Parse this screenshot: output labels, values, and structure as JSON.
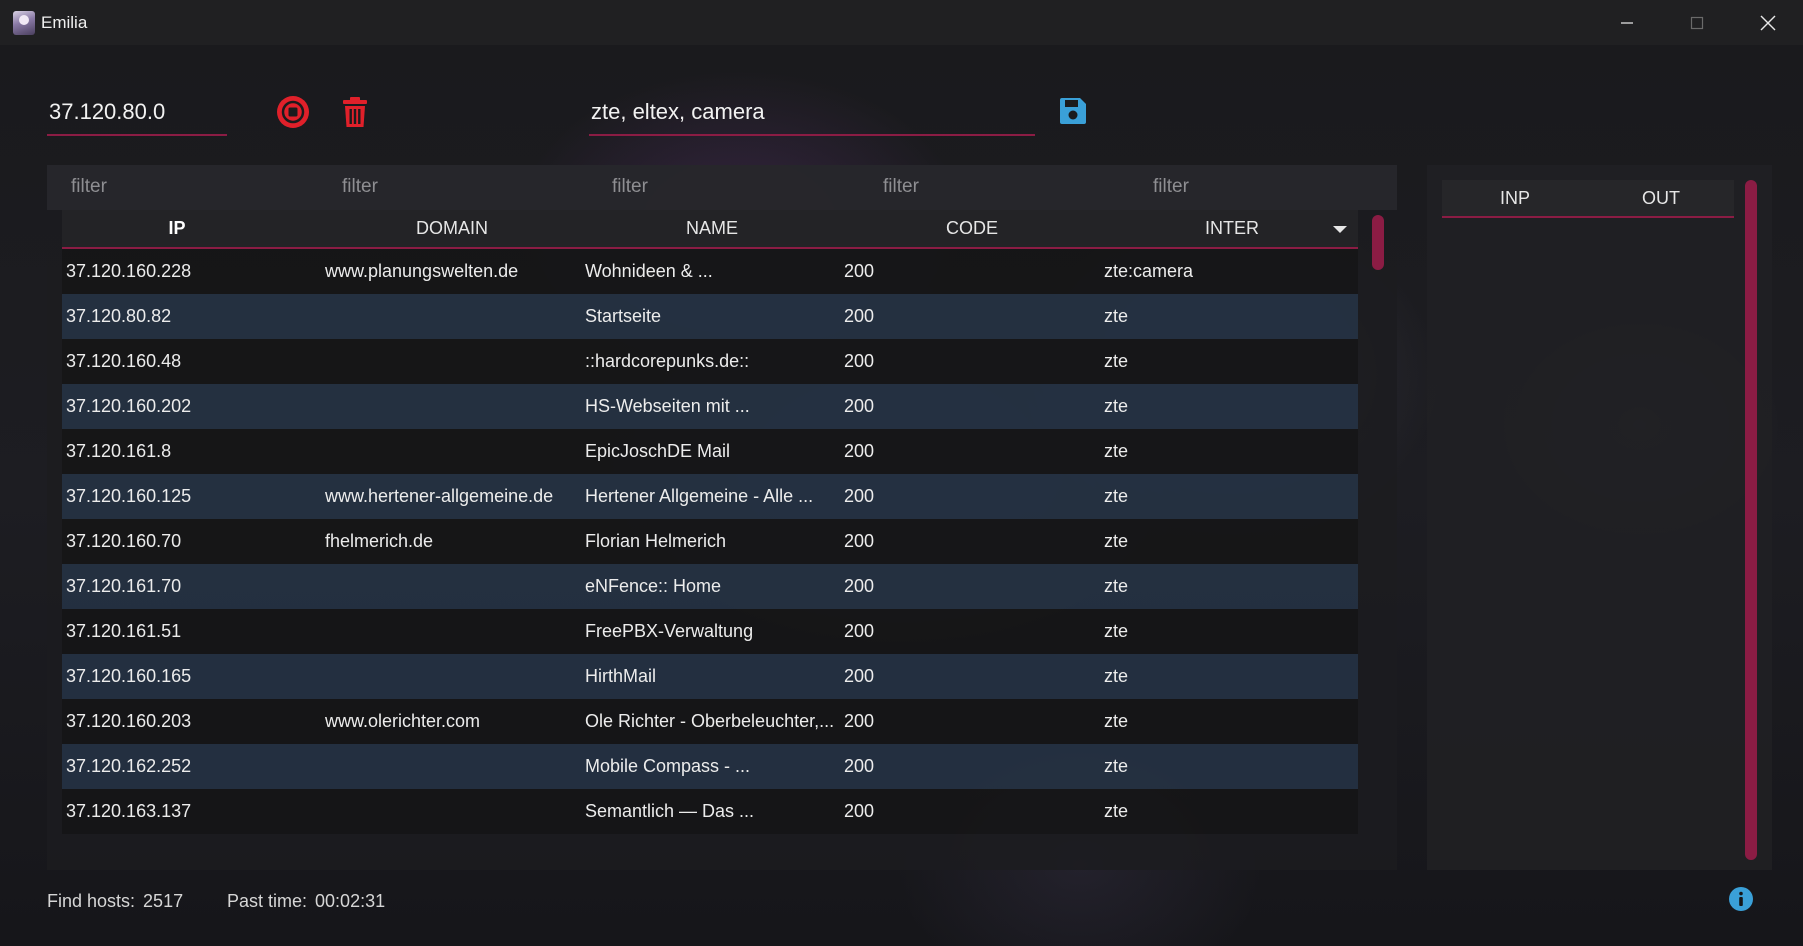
{
  "window": {
    "title": "Emilia",
    "controls": {
      "minimize": "minimize-icon",
      "maximize": "maximize-icon",
      "close": "close-icon"
    }
  },
  "toolbar": {
    "ip_value": "37.120.80.0",
    "tags_value": "zte, eltex, camera",
    "stop_icon": "stop-circle-icon",
    "trash_icon": "trash-icon",
    "save_icon": "floppy-disk-icon"
  },
  "colors": {
    "accent": "#8b1c44",
    "stop": "#e0202a",
    "save": "#3aa0d8",
    "row_alt": "#26344a"
  },
  "table": {
    "filter_placeholders": [
      "filter",
      "filter",
      "filter",
      "filter",
      "filter"
    ],
    "columns": [
      "IP",
      "DOMAIN",
      "NAME",
      "CODE",
      "INTER"
    ],
    "sorted_column": "INTER",
    "rows": [
      {
        "ip": "37.120.160.228",
        "domain": "www.planungswelten.de",
        "name": "Wohnideen & ...",
        "code": "200",
        "inter": "zte:camera"
      },
      {
        "ip": "37.120.80.82",
        "domain": "",
        "name": "Startseite",
        "code": "200",
        "inter": "zte"
      },
      {
        "ip": "37.120.160.48",
        "domain": "",
        "name": "::hardcorepunks.de::",
        "code": "200",
        "inter": "zte"
      },
      {
        "ip": "37.120.160.202",
        "domain": "",
        "name": "HS-Webseiten mit ...",
        "code": "200",
        "inter": "zte"
      },
      {
        "ip": "37.120.161.8",
        "domain": "",
        "name": "EpicJoschDE Mail",
        "code": "200",
        "inter": "zte"
      },
      {
        "ip": "37.120.160.125",
        "domain": "www.hertener-allgemeine.de",
        "name": "Hertener Allgemeine - Alle ...",
        "code": "200",
        "inter": "zte"
      },
      {
        "ip": "37.120.160.70",
        "domain": "fhelmerich.de",
        "name": "Florian Helmerich",
        "code": "200",
        "inter": "zte"
      },
      {
        "ip": "37.120.161.70",
        "domain": "",
        "name": "eNFence:: Home",
        "code": "200",
        "inter": "zte"
      },
      {
        "ip": "37.120.161.51",
        "domain": "",
        "name": "FreePBX-Verwaltung",
        "code": "200",
        "inter": "zte"
      },
      {
        "ip": "37.120.160.165",
        "domain": "",
        "name": "HirthMail",
        "code": "200",
        "inter": "zte"
      },
      {
        "ip": "37.120.160.203",
        "domain": "www.olerichter.com",
        "name": "Ole Richter - Oberbeleuchter,...",
        "code": "200",
        "inter": "zte"
      },
      {
        "ip": "37.120.162.252",
        "domain": "",
        "name": "Mobile Compass - ...",
        "code": "200",
        "inter": "zte"
      },
      {
        "ip": "37.120.163.137",
        "domain": "",
        "name": "Semantlich — Das ...",
        "code": "200",
        "inter": "zte"
      }
    ]
  },
  "side_panel": {
    "columns": [
      "INP",
      "OUT"
    ]
  },
  "status": {
    "find_label": "Find hosts:",
    "find_value": "2517",
    "time_label": "Past time:",
    "time_value": "00:02:31",
    "info_icon": "info-icon"
  }
}
